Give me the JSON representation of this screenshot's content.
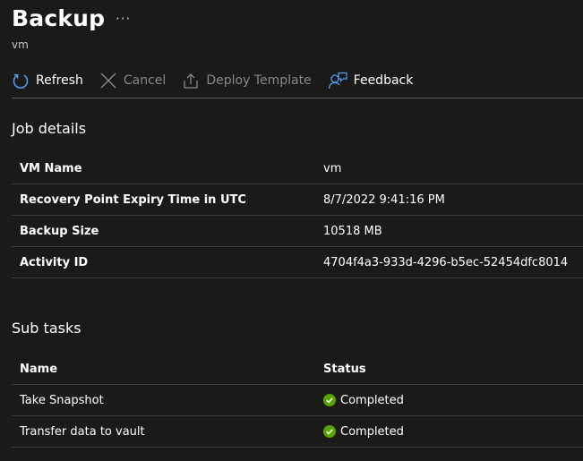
{
  "header": {
    "title": "Backup",
    "more": "···",
    "subtitle": "vm"
  },
  "toolbar": {
    "refresh": "Refresh",
    "cancel": "Cancel",
    "deploy_template": "Deploy Template",
    "feedback": "Feedback"
  },
  "job_details": {
    "title": "Job details",
    "rows": [
      {
        "label": "VM Name",
        "value": "vm"
      },
      {
        "label": "Recovery Point Expiry Time in UTC",
        "value": "8/7/2022 9:41:16 PM"
      },
      {
        "label": "Backup Size",
        "value": "10518 MB"
      },
      {
        "label": "Activity ID",
        "value": "4704f4a3-933d-4296-b5ec-52454dfc8014"
      }
    ]
  },
  "sub_tasks": {
    "title": "Sub tasks",
    "columns": [
      "Name",
      "Status"
    ],
    "rows": [
      {
        "name": "Take Snapshot",
        "status": "Completed"
      },
      {
        "name": "Transfer data to vault",
        "status": "Completed"
      }
    ]
  },
  "colors": {
    "accent": "#4ea1f3",
    "success": "#57a300",
    "background": "#1b1a19"
  },
  "icons": {
    "refresh": "refresh-icon",
    "cancel": "cancel-icon",
    "deploy": "upload-icon",
    "feedback": "feedback-icon",
    "status": "check-circle-icon"
  }
}
